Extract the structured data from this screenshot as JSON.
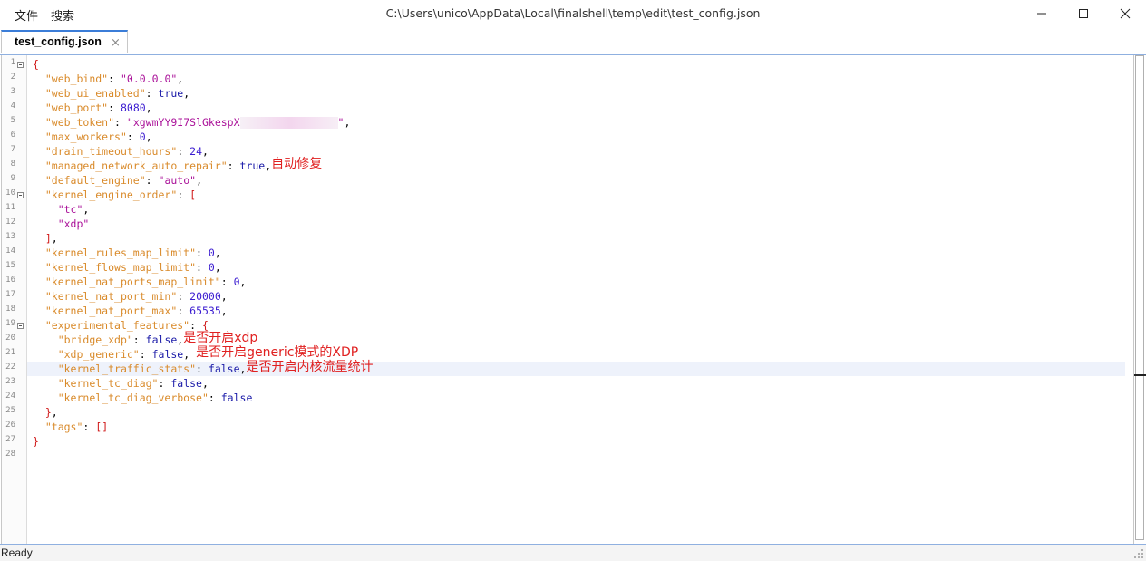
{
  "menu": {
    "file": "文件",
    "search": "搜索"
  },
  "window": {
    "title": "C:\\Users\\unico\\AppData\\Local\\finalshell\\temp\\edit\\test_config.json"
  },
  "tab": {
    "label": "test_config.json",
    "close": "×"
  },
  "editor": {
    "current_line": 22,
    "lines": [
      "{",
      "\"web_bind\": \"0.0.0.0\",",
      "\"web_ui_enabled\": true,",
      "\"web_port\": 8080,",
      "\"web_token\": \"xgwmYY9I7SlGkespX",
      "\"max_workers\": 0,",
      "\"drain_timeout_hours\": 24,",
      "\"managed_network_auto_repair\": true,",
      "\"default_engine\": \"auto\",",
      "\"kernel_engine_order\": [",
      "\"tc\",",
      "\"xdp\"",
      "],",
      "\"kernel_rules_map_limit\": 0,",
      "\"kernel_flows_map_limit\": 0,",
      "\"kernel_nat_ports_map_limit\": 0,",
      "\"kernel_nat_port_min\": 20000,",
      "\"kernel_nat_port_max\": 65535,",
      "\"experimental_features\": {",
      "\"bridge_xdp\": false,",
      "\"xdp_generic\": false,",
      "\"kernel_traffic_stats\": false,",
      "\"kernel_tc_diag\": false,",
      "\"kernel_tc_diag_verbose\": false",
      "},",
      "\"tags\": []",
      "}",
      ""
    ],
    "line_numbers": [
      "1",
      "2",
      "3",
      "4",
      "5",
      "6",
      "7",
      "8",
      "9",
      "10",
      "11",
      "12",
      "13",
      "14",
      "15",
      "16",
      "17",
      "18",
      "19",
      "20",
      "21",
      "22",
      "23",
      "24",
      "25",
      "26",
      "27",
      "28"
    ],
    "annotations": {
      "auto_repair": "自动修复",
      "bridge_xdp": "是否开启xdp",
      "xdp_generic": "是否开启generic模式的XDP",
      "traffic_stats": "是否开启内核流量统计"
    }
  },
  "status": {
    "text": "Ready"
  },
  "colors": {
    "key": "#d98a2a",
    "string": "#aa1199",
    "number": "#3a1bd0",
    "boolean": "#1a1aa8",
    "bracket": "#d01818",
    "annotation": "#e02020",
    "tab_accent": "#3b7dd8"
  }
}
